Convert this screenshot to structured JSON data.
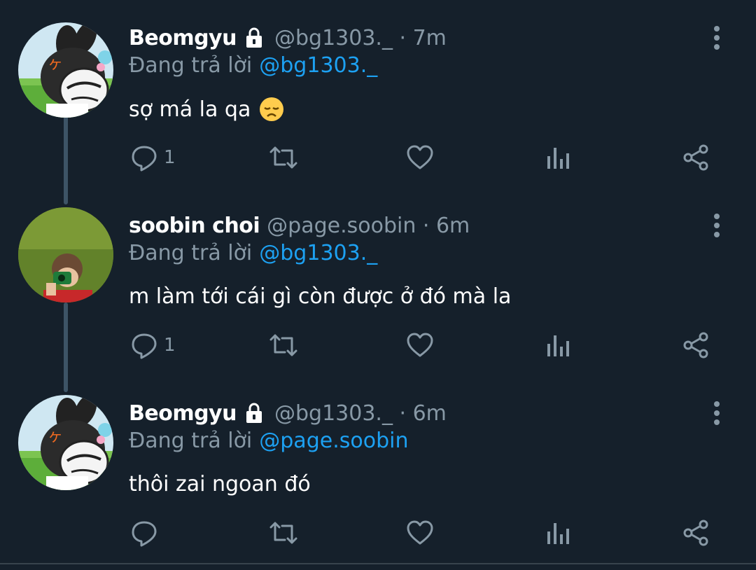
{
  "tweets": [
    {
      "name": "Beomgyu",
      "handle_time": "@bg1303._ · 7m",
      "replying_prefix": "Đang trả lời",
      "replying_to": "@bg1303._",
      "text": "sợ má la qa",
      "has_emoji": true,
      "emoji_icon": "disappointed-face-emoji",
      "locked": true,
      "reply_count": "1",
      "avatar_icon": "cartoon-rabbit-avatar"
    },
    {
      "name": "soobin choi",
      "handle_time": "@page.soobin · 6m",
      "replying_prefix": "Đang trả lời",
      "replying_to": "@bg1303._",
      "text": "m làm tới cái gì còn được ở đó mà la",
      "has_emoji": false,
      "locked": false,
      "reply_count": "1",
      "avatar_icon": "grass-photo-avatar"
    },
    {
      "name": "Beomgyu",
      "handle_time": "@bg1303._ · 6m",
      "replying_prefix": "Đang trả lời",
      "replying_to": "@page.soobin",
      "text": "thôi zai ngoan đó",
      "has_emoji": false,
      "locked": true,
      "reply_count": "",
      "avatar_icon": "cartoon-rabbit-avatar"
    }
  ],
  "colors": {
    "background": "#15202b",
    "primary_text": "#ffffff",
    "secondary_text": "#8899a6",
    "link": "#1da1f2",
    "thread_line": "#3d5466"
  },
  "icons": {
    "reply": "reply-icon",
    "retweet": "retweet-icon",
    "like": "heart-icon",
    "analytics": "analytics-icon",
    "share": "share-icon",
    "more": "more-vertical-icon",
    "lock": "lock-icon"
  }
}
